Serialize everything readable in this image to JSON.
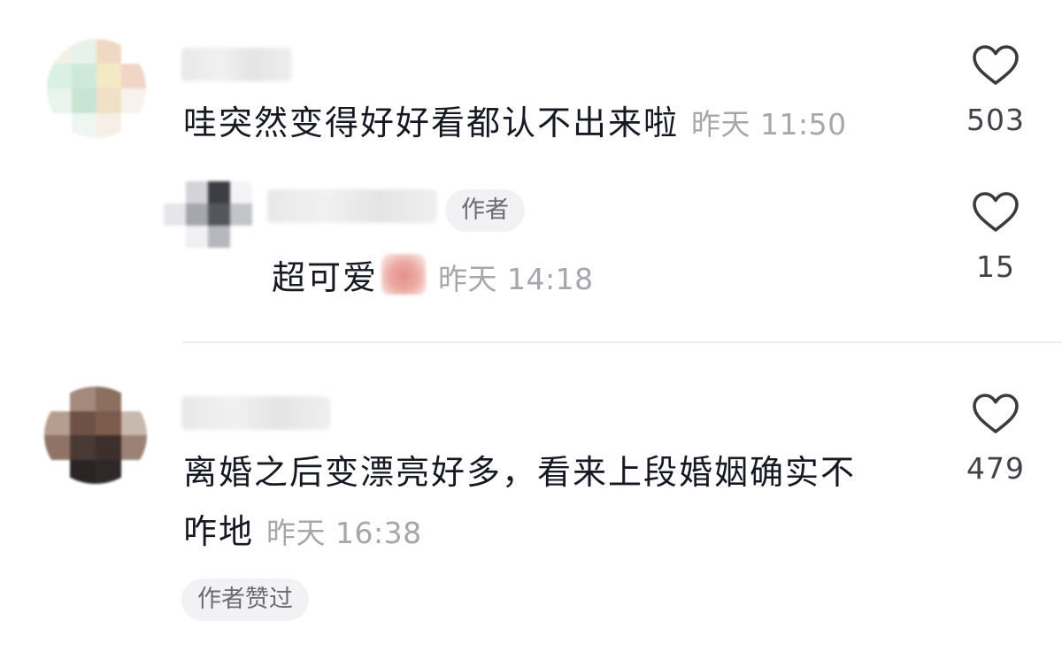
{
  "comments": [
    {
      "text": "哇突然变得好好看都认不出来啦",
      "time": "昨天 11:50",
      "likes": "503"
    },
    {
      "author_badge": "作者",
      "text": "超可爱",
      "time": "昨天 14:18",
      "likes": "15"
    },
    {
      "text_line1": "离婚之后变漂亮好多，看来上段婚姻确实不",
      "text_line2": "咋地",
      "time": "昨天 16:38",
      "likes": "479",
      "author_liked_badge": "作者赞过"
    }
  ],
  "icons": {
    "like": "heart-outline-icon"
  },
  "colors": {
    "text": "#161823",
    "secondary": "#a6a7ab",
    "badge_bg": "#f2f2f4"
  }
}
